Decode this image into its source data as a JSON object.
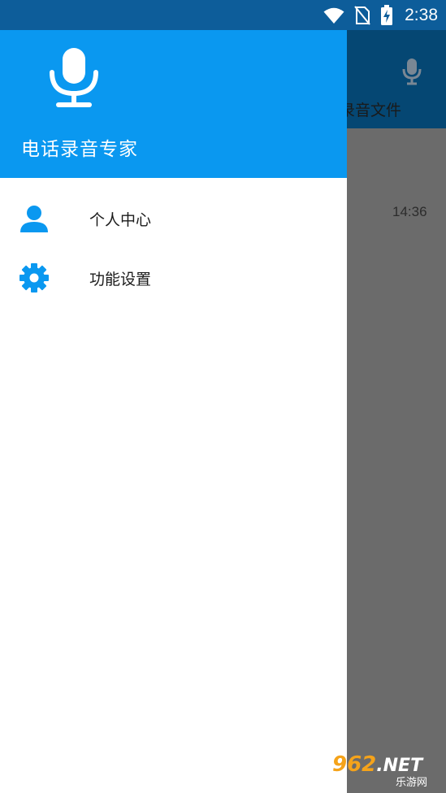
{
  "status_bar": {
    "time": "2:38",
    "icons": [
      "wifi-icon",
      "no-sim-icon",
      "battery-charging-icon"
    ]
  },
  "drawer": {
    "header": {
      "icon": "microphone-icon",
      "title": "电话录音专家"
    },
    "items": [
      {
        "label": "个人中心",
        "icon": "person-icon"
      },
      {
        "label": "功能设置",
        "icon": "gear-icon"
      }
    ]
  },
  "background_app": {
    "tab_label": "录音文件",
    "tab_icon": "microphone-icon",
    "row_time": "14:36"
  },
  "watermark": {
    "main": "962",
    "suffix": ".NET",
    "sub": "乐游网"
  },
  "colors": {
    "drawer_header": "#0a98f0",
    "status_bar": "#0d5d9a",
    "dim_overlay": "#6b6b6b",
    "accent": "#0a98f0"
  }
}
